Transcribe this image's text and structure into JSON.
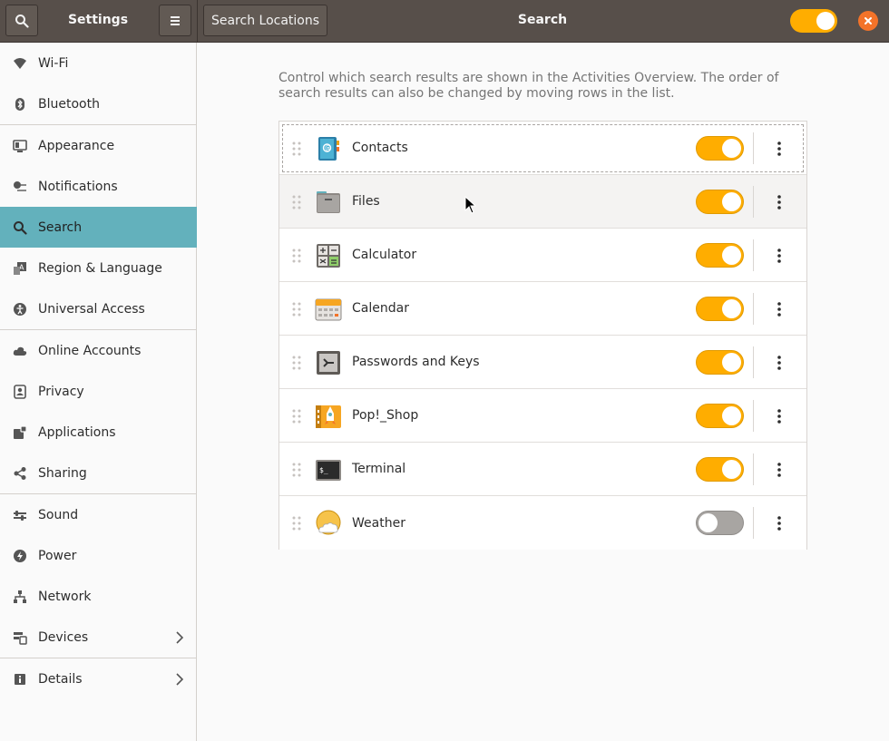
{
  "header": {
    "settings_title": "Settings",
    "search_locations_label": "Search Locations",
    "page_title": "Search",
    "master_switch_on": true
  },
  "sidebar": {
    "items": [
      {
        "label": "Wi-Fi",
        "icon": "wifi-icon"
      },
      {
        "label": "Bluetooth",
        "icon": "bluetooth-icon"
      },
      {
        "label": "Appearance",
        "icon": "appearance-icon"
      },
      {
        "label": "Notifications",
        "icon": "notifications-icon"
      },
      {
        "label": "Search",
        "icon": "search-icon",
        "active": true
      },
      {
        "label": "Region & Language",
        "icon": "region-language-icon"
      },
      {
        "label": "Universal Access",
        "icon": "universal-access-icon"
      },
      {
        "label": "Online Accounts",
        "icon": "cloud-icon"
      },
      {
        "label": "Privacy",
        "icon": "privacy-icon"
      },
      {
        "label": "Applications",
        "icon": "applications-icon"
      },
      {
        "label": "Sharing",
        "icon": "sharing-icon"
      },
      {
        "label": "Sound",
        "icon": "sound-icon"
      },
      {
        "label": "Power",
        "icon": "power-icon"
      },
      {
        "label": "Network",
        "icon": "network-icon"
      },
      {
        "label": "Devices",
        "icon": "devices-icon",
        "submenu": true
      },
      {
        "label": "Details",
        "icon": "info-icon",
        "submenu": true
      }
    ]
  },
  "main": {
    "description": "Control which search results are shown in the Activities Overview. The order of search results can also be changed by moving rows in the list.",
    "providers": [
      {
        "name": "Contacts",
        "icon": "contacts-icon",
        "enabled": true
      },
      {
        "name": "Files",
        "icon": "files-icon",
        "enabled": true
      },
      {
        "name": "Calculator",
        "icon": "calculator-icon",
        "enabled": true
      },
      {
        "name": "Calendar",
        "icon": "calendar-icon",
        "enabled": true
      },
      {
        "name": "Passwords and Keys",
        "icon": "passwords-keys-icon",
        "enabled": true
      },
      {
        "name": "Pop!_Shop",
        "icon": "pop-shop-icon",
        "enabled": true
      },
      {
        "name": "Terminal",
        "icon": "terminal-icon",
        "enabled": true
      },
      {
        "name": "Weather",
        "icon": "weather-icon",
        "enabled": false
      }
    ]
  },
  "colors": {
    "accent": "#ffad00",
    "selection": "#63b1bc",
    "header": "#574f4a",
    "close": "#f37329"
  }
}
